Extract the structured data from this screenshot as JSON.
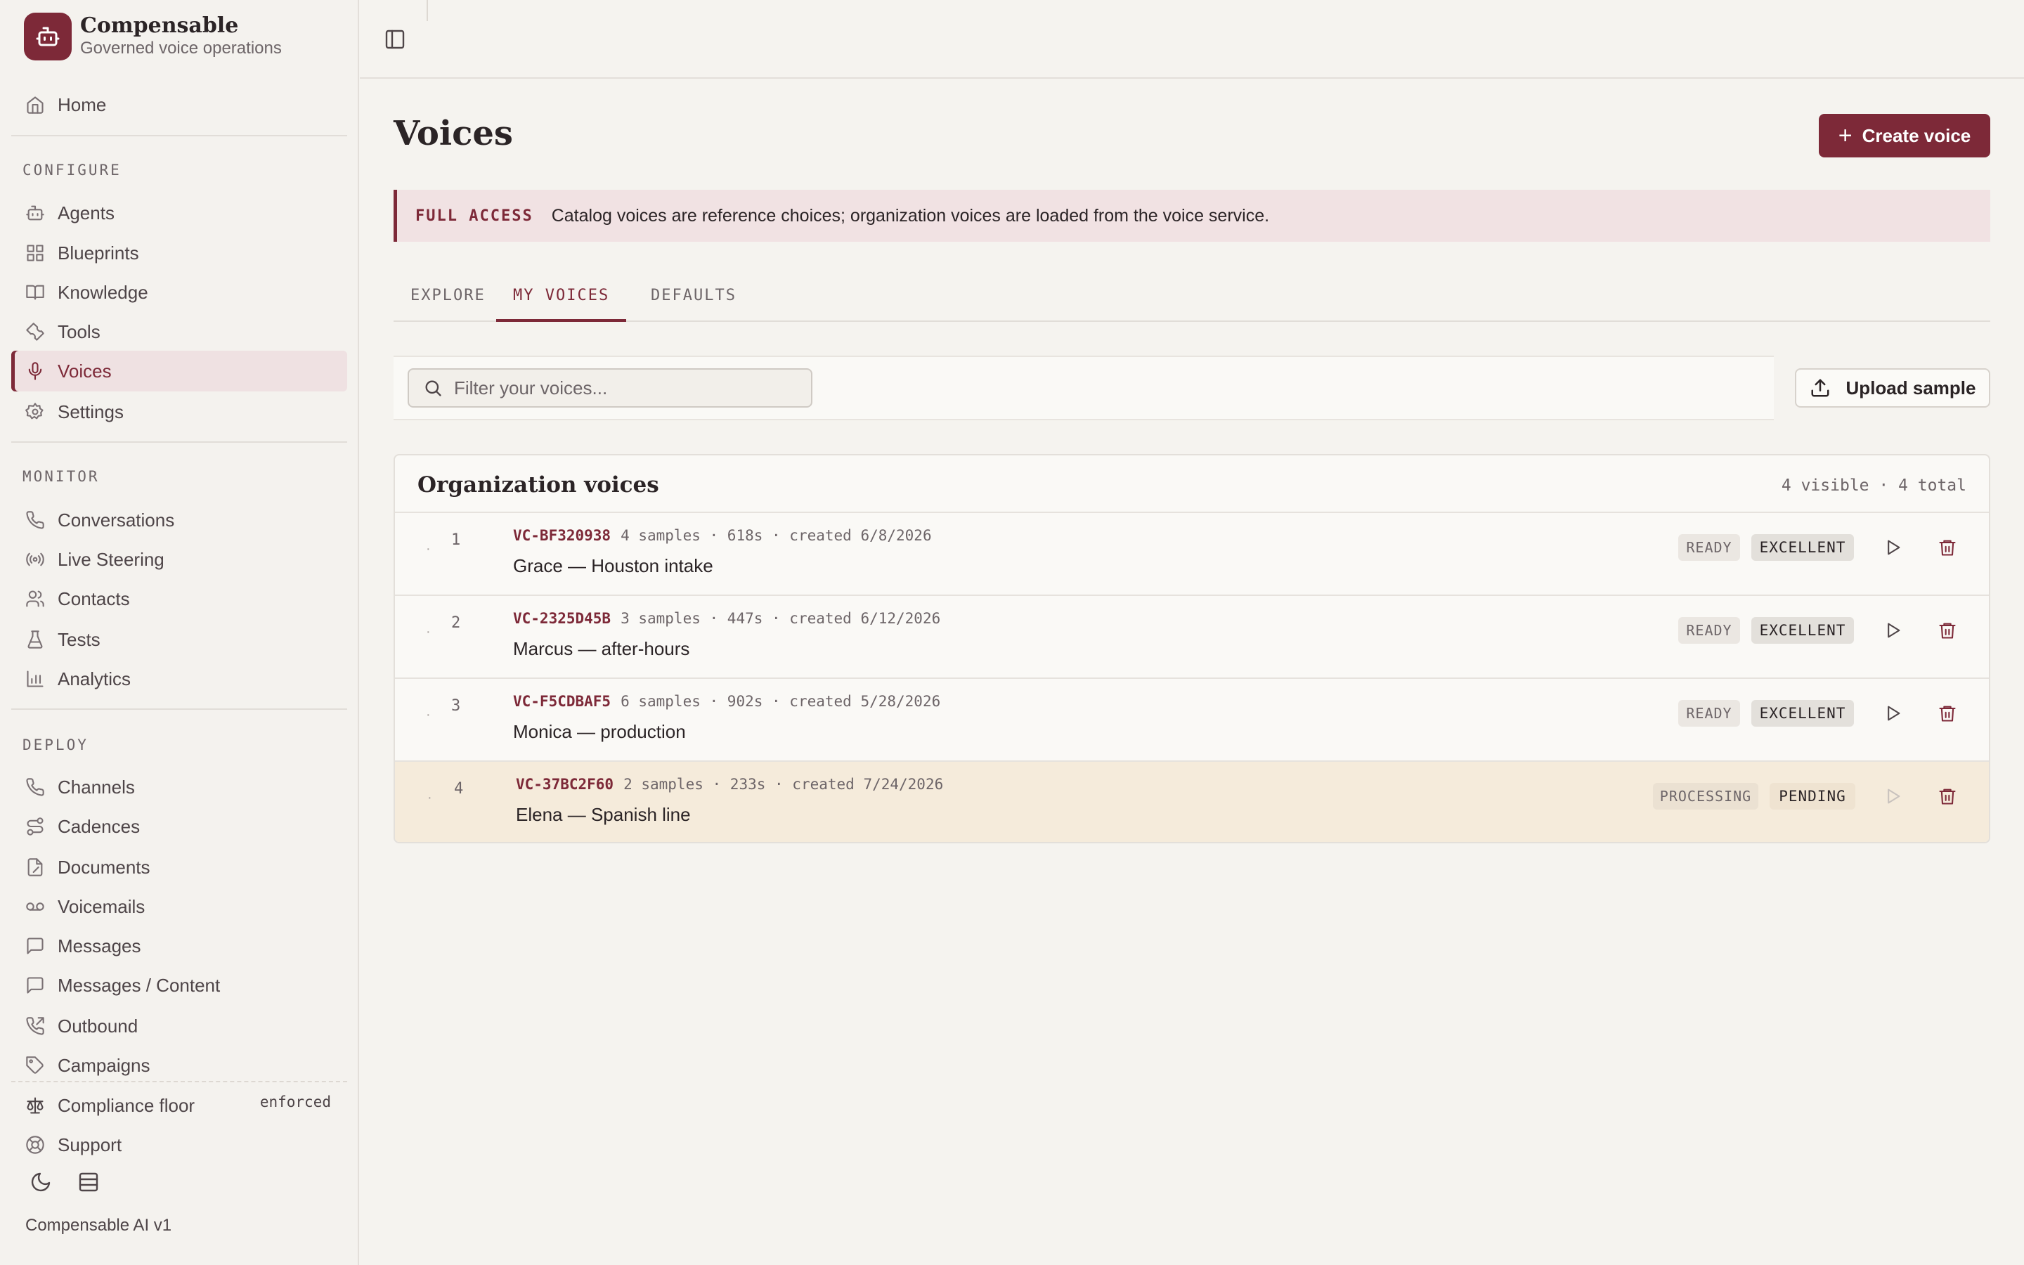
{
  "brand": {
    "name": "Compensable",
    "subtitle": "Governed voice operations"
  },
  "nav": {
    "home": "Home",
    "configure_label": "CONFIGURE",
    "configure": [
      "Agents",
      "Blueprints",
      "Knowledge",
      "Tools",
      "Voices",
      "Settings"
    ],
    "monitor_label": "MONITOR",
    "monitor": [
      "Conversations",
      "Live Steering",
      "Contacts",
      "Tests",
      "Analytics"
    ],
    "deploy_label": "DEPLOY",
    "deploy": [
      "Channels",
      "Cadences",
      "Documents",
      "Voicemails",
      "Messages",
      "Messages / Content",
      "Outbound",
      "Campaigns"
    ],
    "active": "Voices"
  },
  "footer": {
    "compliance": "Compliance floor",
    "compliance_status": "enforced",
    "support": "Support",
    "version": "Compensable AI v1"
  },
  "page": {
    "title": "Voices",
    "create_button": "Create voice",
    "banner_tag": "FULL ACCESS",
    "banner_text": "Catalog voices are reference choices; organization voices are loaded from the voice service.",
    "tabs": [
      "EXPLORE",
      "MY VOICES",
      "DEFAULTS"
    ],
    "active_tab": "MY VOICES",
    "search_placeholder": "Filter your voices...",
    "upload_button": "Upload sample"
  },
  "panel": {
    "title": "Organization voices",
    "count": "4 visible · 4 total",
    "rows": [
      {
        "index": "1",
        "id": "VC-BF320938",
        "meta": "4 samples · 618s · created 6/8/2026",
        "name": "Grace — Houston intake",
        "status": "READY",
        "quality": "EXCELLENT"
      },
      {
        "index": "2",
        "id": "VC-2325D45B",
        "meta": "3 samples · 447s · created 6/12/2026",
        "name": "Marcus — after-hours",
        "status": "READY",
        "quality": "EXCELLENT"
      },
      {
        "index": "3",
        "id": "VC-F5CDBAF5",
        "meta": "6 samples · 902s · created 5/28/2026",
        "name": "Monica — production",
        "status": "READY",
        "quality": "EXCELLENT"
      },
      {
        "index": "4",
        "id": "VC-37BC2F60",
        "meta": "2 samples · 233s · created 7/24/2026",
        "name": "Elena — Spanish line",
        "status": "PROCESSING",
        "quality": "PENDING"
      }
    ]
  },
  "colors": {
    "accent": "#7d2938",
    "pending_row": "#f5ebdb",
    "banner": "#f1e2e3"
  }
}
